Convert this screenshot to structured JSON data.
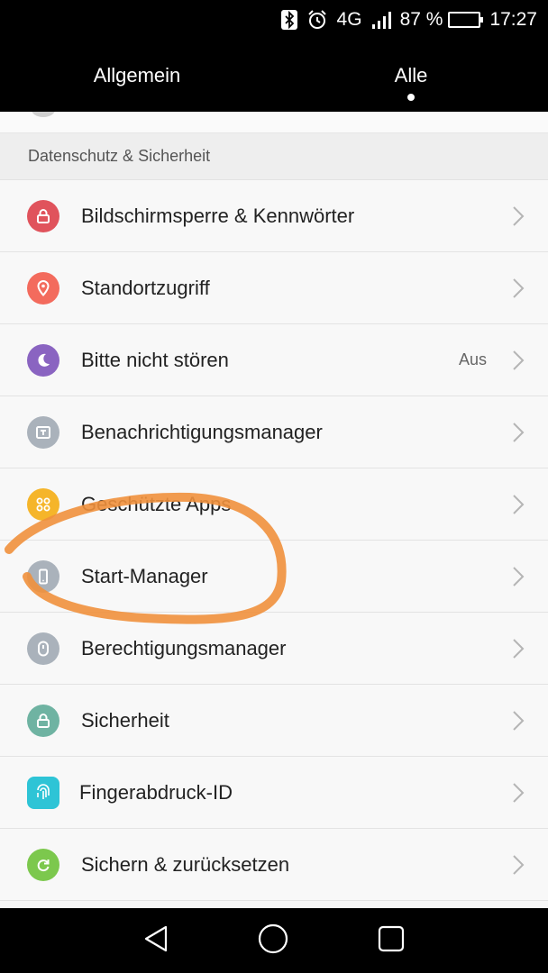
{
  "status_bar": {
    "network": "4G",
    "battery_percent_text": "87 %",
    "battery_level": 0.87,
    "time": "17:27",
    "icons": [
      "bluetooth-icon",
      "alarm-icon",
      "signal-icon",
      "battery-icon"
    ]
  },
  "tabs": [
    {
      "label": "Allgemein",
      "active": false
    },
    {
      "label": "Alle",
      "active": true
    }
  ],
  "section": {
    "title": "Datenschutz & Sicherheit"
  },
  "items": [
    {
      "label": "Bildschirmsperre & Kennwörter",
      "value": "",
      "icon": "lock-icon",
      "color": "#e0535c"
    },
    {
      "label": "Standortzugriff",
      "value": "",
      "icon": "location-pin-icon",
      "color": "#f36b5d"
    },
    {
      "label": "Bitte nicht stören",
      "value": "Aus",
      "icon": "moon-icon",
      "color": "#8a64c1"
    },
    {
      "label": "Benachrichtigungsmanager",
      "value": "",
      "icon": "notification-icon",
      "color": "#aab2bb"
    },
    {
      "label": "Geschützte Apps",
      "value": "",
      "icon": "apps-grid-icon",
      "color": "#f5b52a"
    },
    {
      "label": "Start-Manager",
      "value": "",
      "icon": "phone-icon",
      "color": "#aab2bb"
    },
    {
      "label": "Berechtigungsmanager",
      "value": "",
      "icon": "permission-icon",
      "color": "#aab2bb"
    },
    {
      "label": "Sicherheit",
      "value": "",
      "icon": "security-lock-icon",
      "color": "#6fb3a2"
    },
    {
      "label": "Fingerabdruck-ID",
      "value": "",
      "icon": "fingerprint-icon",
      "color": "#2ec4d6"
    },
    {
      "label": "Sichern & zurücksetzen",
      "value": "",
      "icon": "backup-icon",
      "color": "#7cc84d"
    }
  ],
  "annotation_color": "#f0903c",
  "nav": [
    "back-icon",
    "home-icon",
    "recents-icon"
  ]
}
